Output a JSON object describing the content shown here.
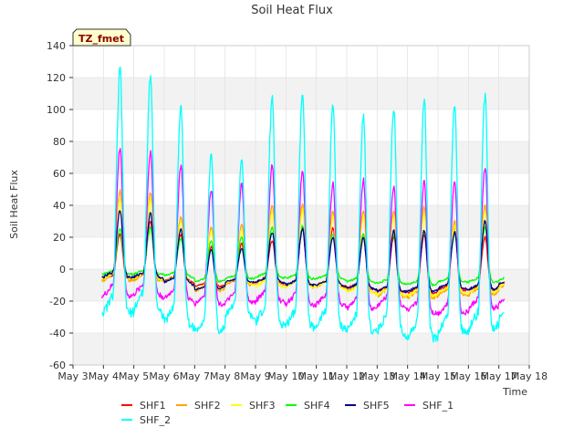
{
  "chart_data": {
    "type": "line",
    "title": "Soil Heat Flux",
    "xlabel": "Time",
    "ylabel": "Soil Heat Flux",
    "badge": "TZ_fmet",
    "xlim": [
      3,
      18
    ],
    "ylim": [
      -60,
      140
    ],
    "x_ticks": [
      3,
      4,
      5,
      6,
      7,
      8,
      9,
      10,
      11,
      12,
      13,
      14,
      15,
      16,
      17,
      18
    ],
    "x_tick_labels": [
      "May 3",
      "May 4",
      "May 5",
      "May 6",
      "May 7",
      "May 8",
      "May 9",
      "May 10",
      "May 11",
      "May 12",
      "May 13",
      "May 14",
      "May 15",
      "May 16",
      "May 17",
      "May 18"
    ],
    "y_ticks": [
      -60,
      -40,
      -20,
      0,
      20,
      40,
      60,
      80,
      100,
      120,
      140
    ],
    "y_tick_labels": [
      "-60",
      "-40",
      "-20",
      "0",
      "20",
      "40",
      "60",
      "80",
      "100",
      "120",
      "140"
    ],
    "grid": true,
    "legend_position": "bottom",
    "band_color": "#f2f2f2",
    "series": [
      {
        "name": "SHF1",
        "color": "#ff0000",
        "peaks": [
          22,
          30,
          22,
          14,
          16,
          18,
          25,
          26,
          20,
          20,
          22,
          26,
          20,
          26,
          7
        ],
        "troughs": [
          -6,
          -6,
          -7,
          -11,
          -9,
          -8,
          -10,
          -10,
          -12,
          -14,
          -15,
          -13,
          -13,
          -10,
          -5
        ]
      },
      {
        "name": "SHF2",
        "color": "#ffa500",
        "peaks": [
          49,
          48,
          33,
          26,
          28,
          40,
          41,
          36,
          37,
          37,
          39,
          30,
          40,
          35,
          8
        ],
        "troughs": [
          -7,
          -7,
          -8,
          -14,
          -10,
          -9,
          -11,
          -11,
          -14,
          -17,
          -18,
          -16,
          -16,
          -12,
          -6
        ]
      },
      {
        "name": "SHF3",
        "color": "#ffff00",
        "peaks": [
          44,
          44,
          30,
          24,
          25,
          36,
          37,
          33,
          33,
          33,
          35,
          27,
          36,
          31,
          7
        ],
        "troughs": [
          -6,
          -6,
          -8,
          -13,
          -9,
          -11,
          -11,
          -11,
          -15,
          -16,
          -17,
          -15,
          -15,
          -11,
          -5
        ]
      },
      {
        "name": "SHF4",
        "color": "#00ff00",
        "peaks": [
          25,
          26,
          19,
          18,
          20,
          26,
          27,
          22,
          22,
          22,
          24,
          22,
          26,
          25,
          6
        ],
        "troughs": [
          -3,
          -3,
          -4,
          -8,
          -6,
          -5,
          -6,
          -6,
          -8,
          -9,
          -10,
          -8,
          -8,
          -7,
          -3
        ]
      },
      {
        "name": "SHF5",
        "color": "#00008b",
        "peaks": [
          37,
          35,
          25,
          12,
          13,
          23,
          25,
          20,
          20,
          24,
          24,
          23,
          30,
          6,
          5
        ],
        "troughs": [
          -5,
          -5,
          -8,
          -13,
          -8,
          -8,
          -10,
          -10,
          -12,
          -14,
          -14,
          -12,
          -13,
          -9,
          -5
        ]
      },
      {
        "name": "SHF_1",
        "color": "#ff00ff",
        "peaks": [
          76,
          74,
          65,
          50,
          53,
          65,
          61,
          54,
          56,
          52,
          56,
          56,
          64,
          23,
          20
        ],
        "troughs": [
          -17,
          -16,
          -19,
          -22,
          -21,
          -20,
          -22,
          -22,
          -25,
          -23,
          -27,
          -28,
          -25,
          -21,
          -8
        ]
      },
      {
        "name": "SHF_2",
        "color": "#00ffff",
        "peaks": [
          125,
          122,
          103,
          72,
          69,
          108,
          112,
          104,
          97,
          101,
          107,
          104,
          108,
          31,
          31
        ],
        "troughs": [
          -28,
          -25,
          -34,
          -40,
          -29,
          -34,
          -36,
          -36,
          -39,
          -39,
          -44,
          -40,
          -38,
          -30,
          -16
        ]
      }
    ]
  }
}
